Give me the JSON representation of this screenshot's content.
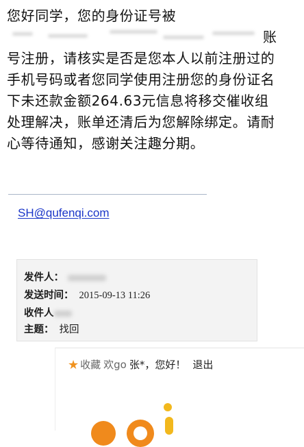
{
  "message": {
    "line1": "您好同学，您的身份证号被",
    "line2_tail": "账",
    "line3": "号注册，请核实是否是您本人以前注册过的",
    "line4": "手机号码或者您同学使用注册您的身份证名",
    "line5": "下未还款金额264.63元信息将移交催收组",
    "line6": "处理解决，账单还清后为您解除绑定。请耐",
    "line7": "心等待通知，感谢关注趣分期。"
  },
  "signature": {
    "email": "SH@qufenqi.com"
  },
  "email_header": {
    "from_label": "发件人：",
    "sent_label": "发送时间：",
    "sent_value": "2015-09-13 11:26",
    "to_label": "收件人",
    "subject_label": "主题：",
    "subject_value": "找回"
  },
  "site_bar": {
    "favorites_label": "收藏",
    "welcome_text": "欢go",
    "user_name": "张*",
    "greeting": "，您好！",
    "logout_label": "退出"
  },
  "colors": {
    "link": "#1a35c8",
    "star": "#f0921e",
    "logo_orange": "#f08a1c"
  }
}
